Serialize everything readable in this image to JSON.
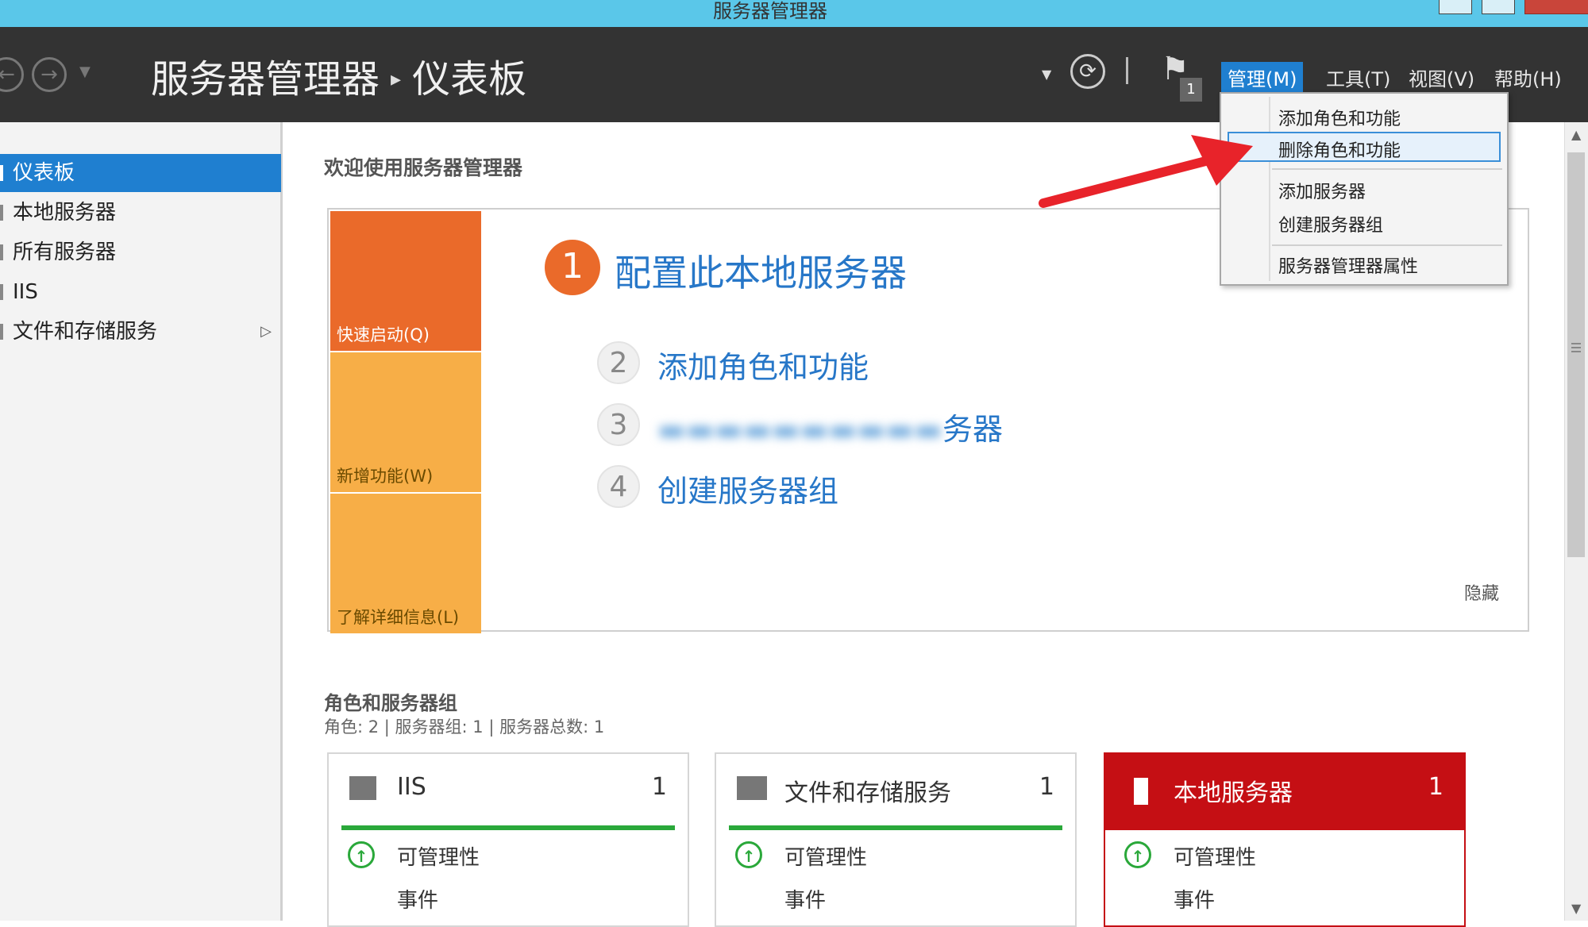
{
  "window": {
    "title": "服务器管理器"
  },
  "header": {
    "breadcrumb_root": "服务器管理器",
    "breadcrumb_page": "仪表板",
    "notification_count": "1",
    "menu": [
      {
        "label": "管理(M)",
        "active": true
      },
      {
        "label": "工具(T)"
      },
      {
        "label": "视图(V)"
      },
      {
        "label": "帮助(H)"
      }
    ]
  },
  "manage_menu": {
    "items": [
      "添加角色和功能",
      "删除角色和功能",
      "添加服务器",
      "创建服务器组",
      "服务器管理器属性"
    ],
    "highlighted": "删除角色和功能"
  },
  "sidebar": {
    "items": [
      {
        "label": "仪表板",
        "selected": true
      },
      {
        "label": "本地服务器"
      },
      {
        "label": "所有服务器"
      },
      {
        "label": "IIS"
      },
      {
        "label": "文件和存储服务",
        "has_submenu": true
      }
    ]
  },
  "welcome": {
    "title": "欢迎使用服务器管理器",
    "tiles": [
      "快速启动(Q)",
      "新增功能(W)",
      "了解详细信息(L)"
    ],
    "steps": [
      {
        "num": "1",
        "label": "配置此本地服务器"
      },
      {
        "num": "2",
        "label": "添加角色和功能"
      },
      {
        "num": "3",
        "label": "务器",
        "obscured": true
      },
      {
        "num": "4",
        "label": "创建服务器组"
      }
    ],
    "hide_label": "隐藏"
  },
  "roles": {
    "title": "角色和服务器组",
    "stats": "角色: 2 | 服务器组: 1 | 服务器总数: 1",
    "cards": [
      {
        "name": "IIS",
        "count": "1",
        "row1": "可管理性",
        "row2": "事件"
      },
      {
        "name": "文件和存储服务",
        "count": "1",
        "row1": "可管理性",
        "row2": "事件"
      },
      {
        "name": "本地服务器",
        "count": "1",
        "row1": "可管理性",
        "row2": "事件",
        "accent": "#c50f14"
      }
    ]
  },
  "colors": {
    "header_bg": "#333333",
    "accent_blue": "#1f7fd0",
    "quick_start_orange": "#ea6a2a",
    "tile_orange": "#f7ae47",
    "status_green": "#2aa83a",
    "alert_red": "#c50f14"
  }
}
